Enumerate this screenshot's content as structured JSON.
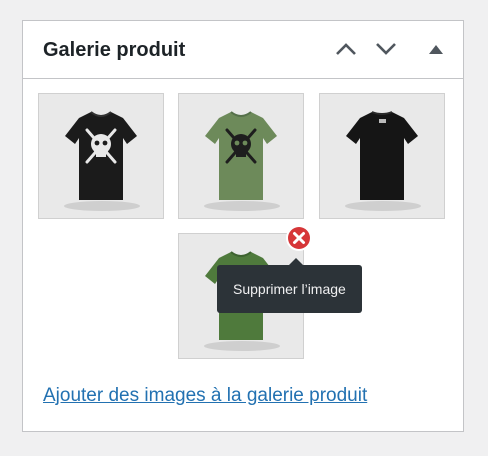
{
  "metabox": {
    "title": "Galerie produit",
    "controls": {
      "move_up_icon": "chevron-up-icon",
      "move_down_icon": "chevron-down-icon",
      "toggle_icon": "triangle-up-icon"
    }
  },
  "gallery": {
    "images": [
      {
        "shirt_color": "#1b1b1b",
        "print": "skull"
      },
      {
        "shirt_color": "#6d8a5a",
        "print": "skull"
      },
      {
        "shirt_color": "#1b1b1b",
        "print": "back"
      },
      {
        "shirt_color": "#4f7a3c",
        "print": "partial"
      }
    ],
    "hovered_index": 3,
    "delete_tooltip": "Supprimer l’image",
    "delete_color": "#d63638"
  },
  "add_link": "Ajouter des images à la galerie produit",
  "colors": {
    "link": "#2271b1",
    "border": "#c3c4c7",
    "title": "#1d2327"
  }
}
